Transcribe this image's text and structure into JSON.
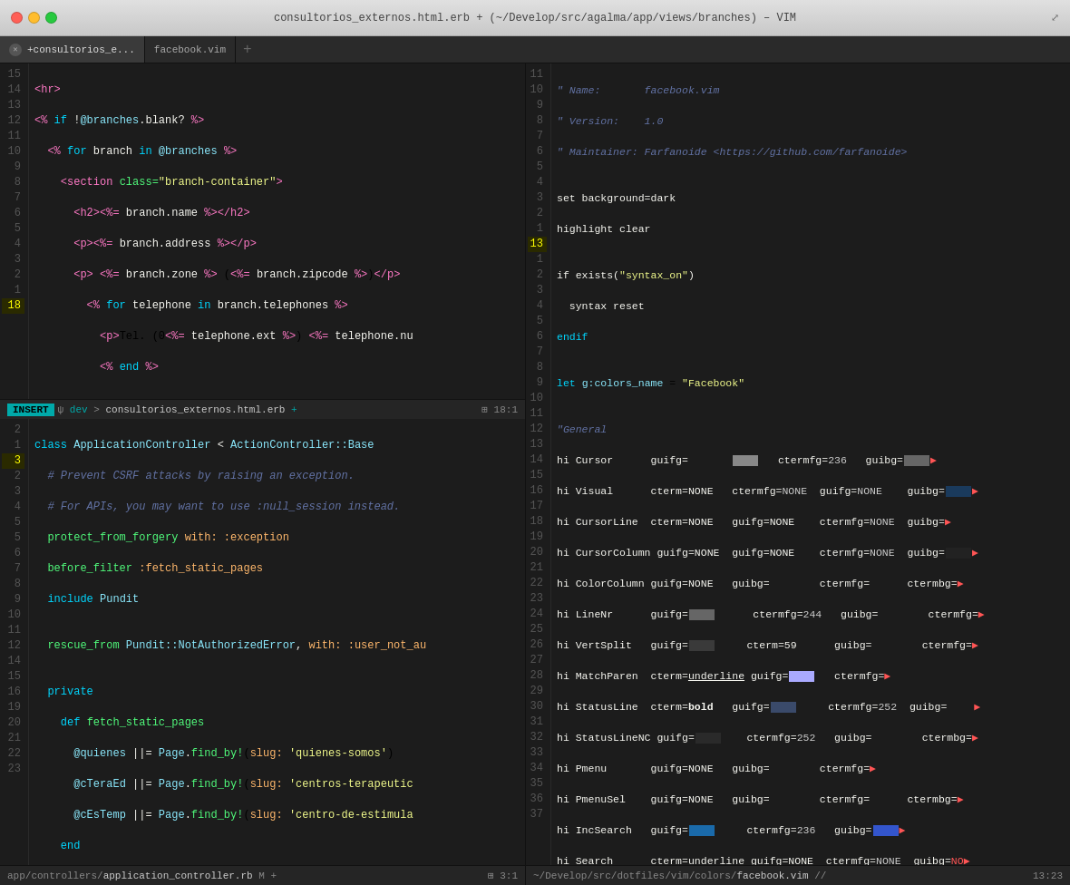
{
  "titlebar": {
    "title": "consultorios_externos.html.erb + (~/Develop/src/agalma/app/views/branches) – VIM",
    "expand_icon": "⤢"
  },
  "tabs": {
    "items": [
      {
        "label": "+consultorios_e...",
        "active": true,
        "closeable": true
      },
      {
        "label": "facebook.vim",
        "active": false,
        "closeable": false
      }
    ],
    "add_label": "+"
  },
  "left_pane": {
    "status": {
      "mode": "INSERT",
      "branch": "dev",
      "file": "consultorios_externos.html.erb",
      "modified": "+",
      "position": "18:1"
    },
    "bottom_status": {
      "file": "app/controllers/application_controller.rb M +",
      "position": "3:1"
    }
  },
  "right_pane": {
    "status": {
      "file": "~/Develop/src/dotfiles/vim/colors/facebook.vim",
      "modified": "//",
      "position": "13:23"
    }
  },
  "colors": {
    "accent": "#00aaaa",
    "background": "#1c1c1c",
    "status_bg": "#252525"
  }
}
